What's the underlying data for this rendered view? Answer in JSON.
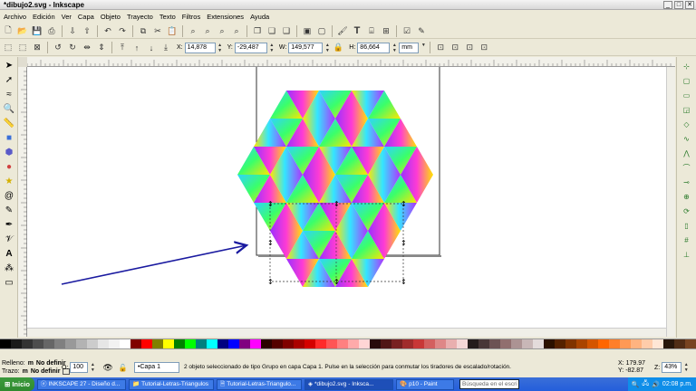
{
  "window": {
    "title": "*dibujo2.svg - Inkscape"
  },
  "menu": [
    "Archivo",
    "Edición",
    "Ver",
    "Capa",
    "Objeto",
    "Trayecto",
    "Texto",
    "Filtros",
    "Extensiones",
    "Ayuda"
  ],
  "toolbar2": {
    "x_label": "X:",
    "x_value": "14,878",
    "y_label": "Y:",
    "y_value": "-29,487",
    "w_label": "W:",
    "w_value": "149,577",
    "h_label": "H:",
    "h_value": "86,664",
    "unit": "mm"
  },
  "icons": {
    "tools": [
      "selector-icon",
      "node-icon",
      "tweak-icon",
      "zoom-icon",
      "measure-icon",
      "rect-icon",
      "3dbox-icon",
      "ellipse-icon",
      "star-icon",
      "spiral-icon",
      "pencil-icon",
      "pen-icon",
      "calligraphy-icon",
      "text-icon",
      "spray-icon",
      "eraser-icon"
    ],
    "snaps": [
      "snap-toggle-icon",
      "snap-bbox-icon",
      "snap-bbox-edge-icon",
      "snap-bbox-corner-icon",
      "snap-nodes-icon",
      "snap-path-icon",
      "snap-cusp-icon",
      "snap-smooth-icon",
      "snap-midpoint-icon",
      "snap-center-icon",
      "snap-rotation-icon",
      "snap-page-icon",
      "snap-grid-icon",
      "snap-guide-icon"
    ]
  },
  "palette": [
    "#000000",
    "#1a1a1a",
    "#333333",
    "#4d4d4d",
    "#666666",
    "#808080",
    "#999999",
    "#b3b3b3",
    "#cccccc",
    "#e6e6e6",
    "#f2f2f2",
    "#ffffff",
    "#800000",
    "#ff0000",
    "#808000",
    "#ffff00",
    "#008000",
    "#00ff00",
    "#008080",
    "#00ffff",
    "#000080",
    "#0000ff",
    "#800080",
    "#ff00ff",
    "#2b0000",
    "#550000",
    "#800000",
    "#aa0000",
    "#d40000",
    "#ff2a2a",
    "#ff5555",
    "#ff8080",
    "#ffaaaa",
    "#ffd5d5",
    "#280b0b",
    "#501616",
    "#782121",
    "#a02c2c",
    "#c83737",
    "#d35f5f",
    "#de8787",
    "#e9afaf",
    "#f4d7d7",
    "#241c1c",
    "#483737",
    "#6c5353",
    "#916f6f",
    "#ac9393",
    "#c8b7b7",
    "#e3dbdb",
    "#2b1100",
    "#552200",
    "#803300",
    "#aa4400",
    "#d45500",
    "#ff6600",
    "#ff7f2a",
    "#ff9955",
    "#ffb380",
    "#ffccaa",
    "#ffe6d5",
    "#28170b",
    "#502d16",
    "#784421"
  ],
  "status": {
    "fill_label": "Relleno:",
    "fill_value": "No definir",
    "stroke_label": "Trazo:",
    "stroke_value": "No definir",
    "fill_mark": "m",
    "stroke_mark": "m",
    "opacity_label": "O:",
    "opacity_value": "100",
    "layer": "•Capa 1",
    "message": "2 objeto seleccionado de tipo Grupo en capa Capa 1. Pulse en la selección para conmutar los tiradores de escalado/rotación.",
    "x_coord_label": "X:",
    "x_coord": "179.97",
    "y_coord_label": "Y:",
    "y_coord": "-82.87",
    "zoom_label": "Z:",
    "zoom": "43%"
  },
  "taskbar": {
    "start": "Inicio",
    "tasks": [
      "INKSCAPE 27 - Diseño d...",
      "Tutorial-Letras-Triangulos",
      "Tutorial-Letras-Triangulo...",
      "*dibujo2.svg - Inksca...",
      "p10 - Paint"
    ],
    "active_task": 3,
    "search_placeholder": "Búsqueda en el escri",
    "clock": "02:08 p.m."
  },
  "gradient_colors": [
    "#9b30ff",
    "#ff3bd4",
    "#ffe600",
    "#33e6ff"
  ]
}
